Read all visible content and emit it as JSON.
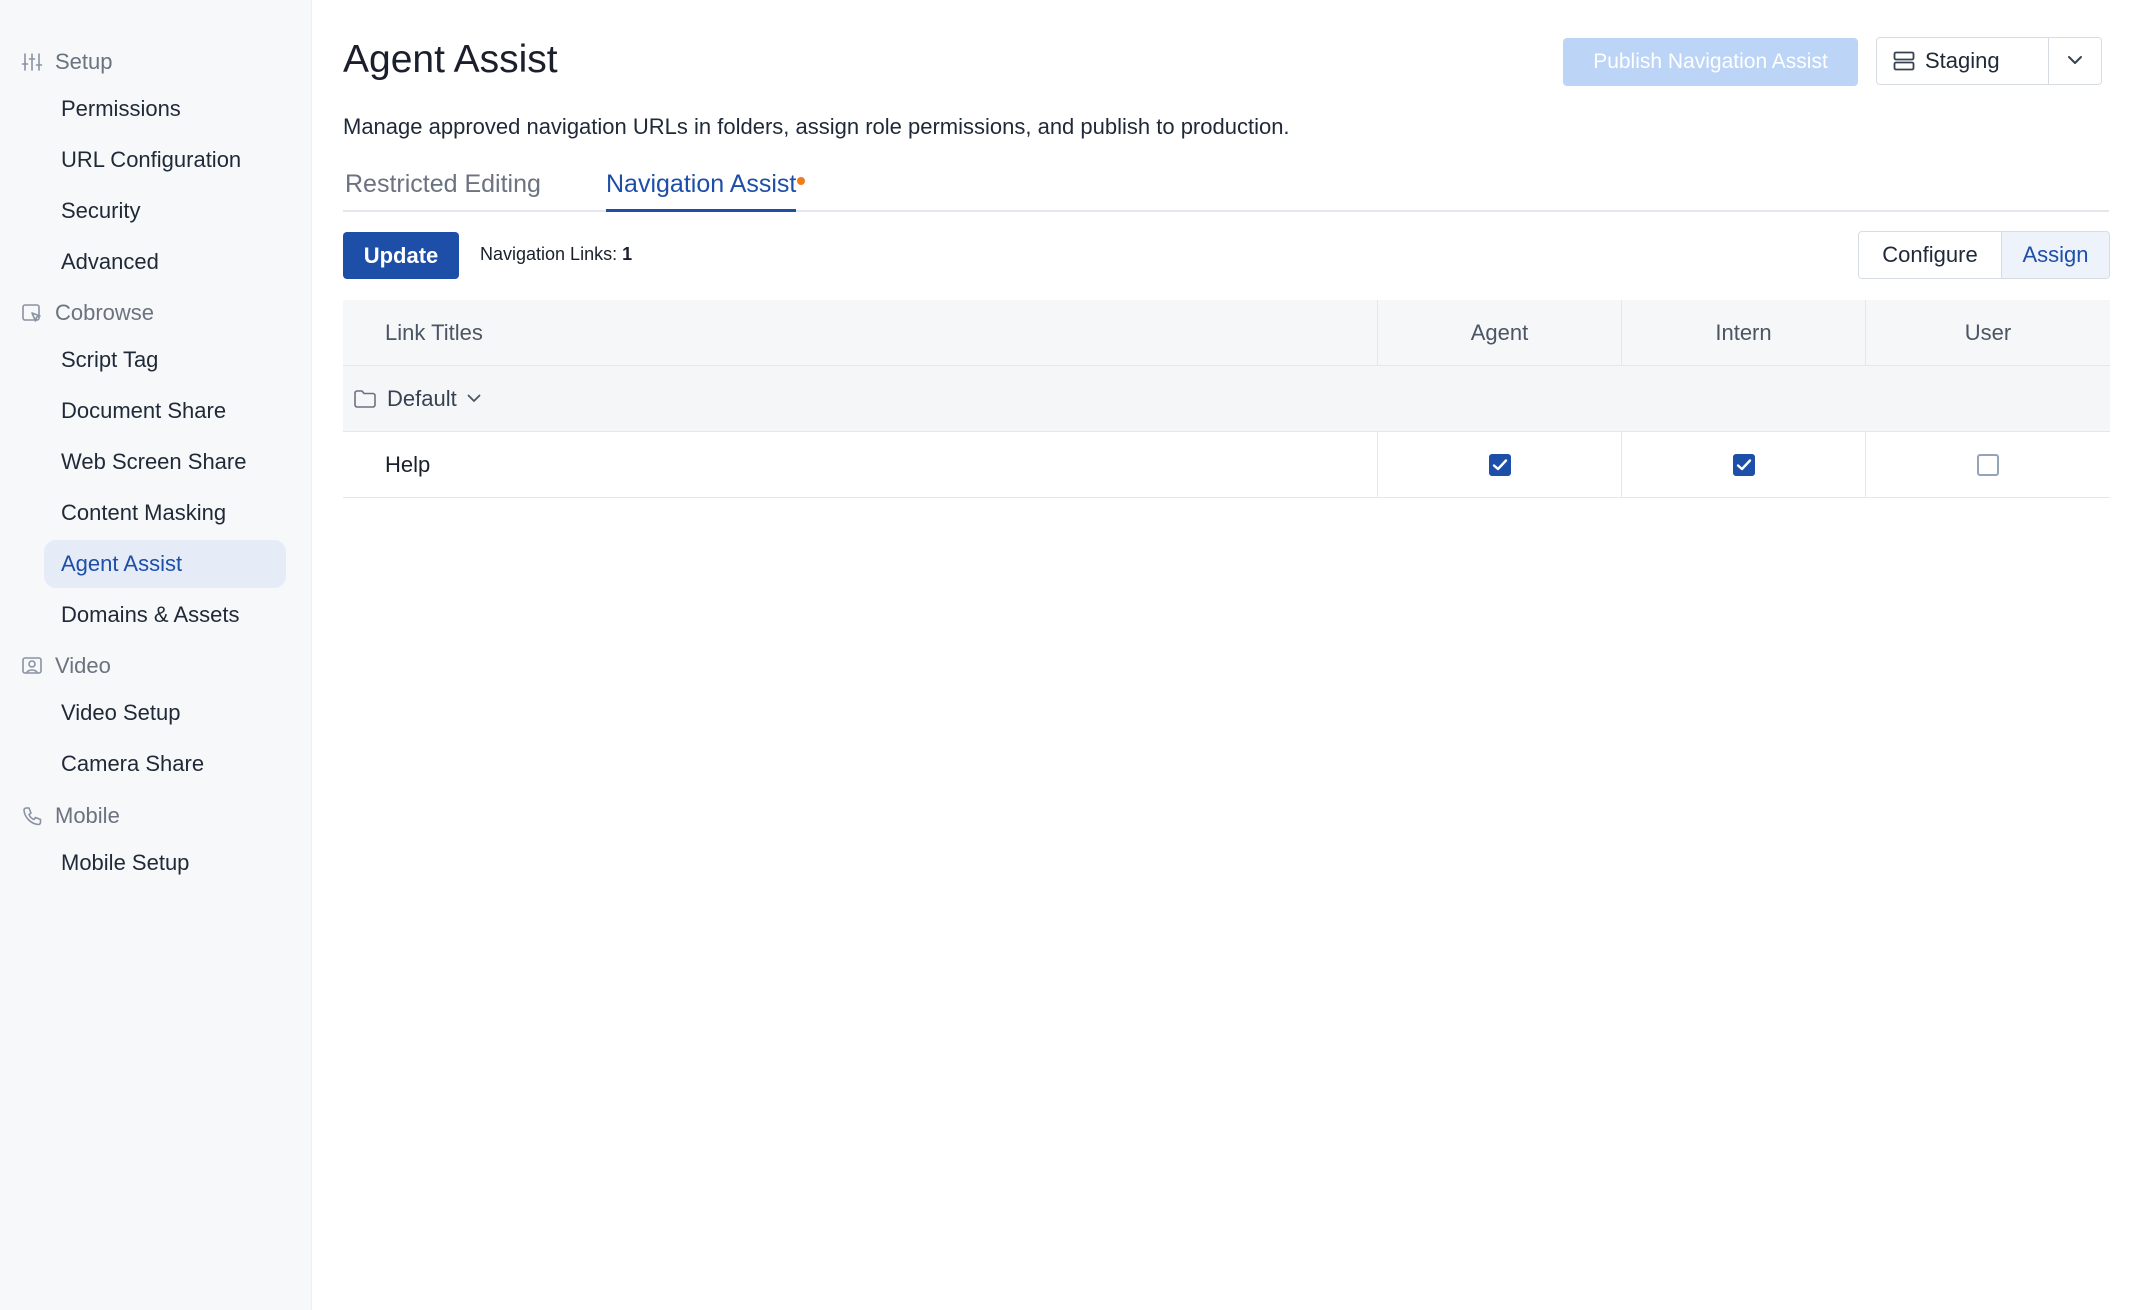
{
  "sidebar": {
    "sections": [
      {
        "label": "Setup",
        "icon": "sliders-icon",
        "items": [
          "Permissions",
          "URL Configuration",
          "Security",
          "Advanced"
        ]
      },
      {
        "label": "Cobrowse",
        "icon": "cobrowse-icon",
        "items": [
          "Script Tag",
          "Document Share",
          "Web Screen Share",
          "Content Masking",
          "Agent Assist",
          "Domains & Assets"
        ]
      },
      {
        "label": "Video",
        "icon": "video-icon",
        "items": [
          "Video Setup",
          "Camera Share"
        ]
      },
      {
        "label": "Mobile",
        "icon": "phone-icon",
        "items": [
          "Mobile Setup"
        ]
      }
    ],
    "active_item": "Agent Assist"
  },
  "header": {
    "title": "Agent Assist",
    "description": "Manage approved navigation URLs in folders, assign role permissions, and publish to production.",
    "publish_label": "Publish Navigation Assist",
    "environment": "Staging"
  },
  "tabs": [
    {
      "label": "Restricted Editing",
      "active": false
    },
    {
      "label": "Navigation Assist",
      "active": true,
      "has_unsaved_dot": true
    }
  ],
  "toolbar": {
    "update_label": "Update",
    "links_label": "Navigation Links:",
    "links_count": "1",
    "configure_label": "Configure",
    "assign_label": "Assign"
  },
  "table": {
    "columns": [
      "Link Titles",
      "Agent",
      "Intern",
      "User"
    ],
    "folder": "Default",
    "rows": [
      {
        "title": "Help",
        "agent": true,
        "intern": true,
        "user": false
      }
    ]
  },
  "colors": {
    "accent": "#1d4ea8",
    "publish_disabled": "#bcd4f6",
    "unsaved_dot": "#f07d1c"
  }
}
